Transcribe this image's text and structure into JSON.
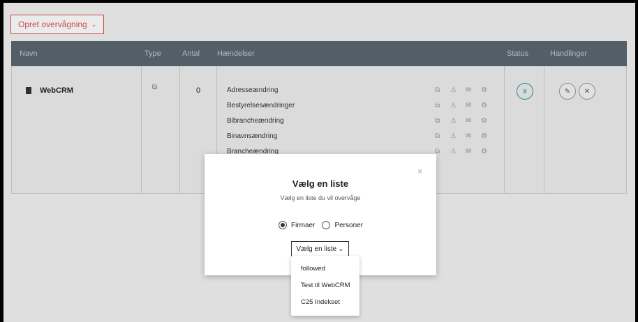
{
  "toolbar": {
    "create_label": "Opret overvågning",
    "create_chevron": "⌄"
  },
  "table": {
    "headers": {
      "name": "Navn",
      "type": "Type",
      "count": "Antal",
      "events": "Hændelser",
      "status": "Status",
      "actions": "Handlinger"
    },
    "row": {
      "name": "WebCRM",
      "type_icon": "company-tag-icon",
      "type_glyph": "⧉",
      "count": "0",
      "events": [
        "Adresseændring",
        "Bestyrelsesændringer",
        "Bibrancheændring",
        "Binavnsændring",
        "Brancheændring"
      ],
      "event_icons": {
        "tag": "⧉",
        "warn": "⚠",
        "mail": "✉",
        "bell": "⚙"
      },
      "status_glyph": "II",
      "edit_glyph": "✎",
      "delete_glyph": "✕"
    }
  },
  "modal": {
    "close_glyph": "×",
    "title": "Vælg en liste",
    "subtitle": "Vælg en liste du vil overvåge",
    "radio_companies": "Firmaer",
    "radio_persons": "Personer",
    "selected_radio": "Firmaer",
    "select_label": "Vælg en liste",
    "select_chevron": "⌄"
  },
  "dropdown": {
    "options": [
      "followed",
      "Test til WebCRM",
      "C25 Indekset"
    ]
  },
  "colors": {
    "accent": "#d9534f",
    "header_bg": "#5b6670",
    "status": "#2a9d8f"
  }
}
